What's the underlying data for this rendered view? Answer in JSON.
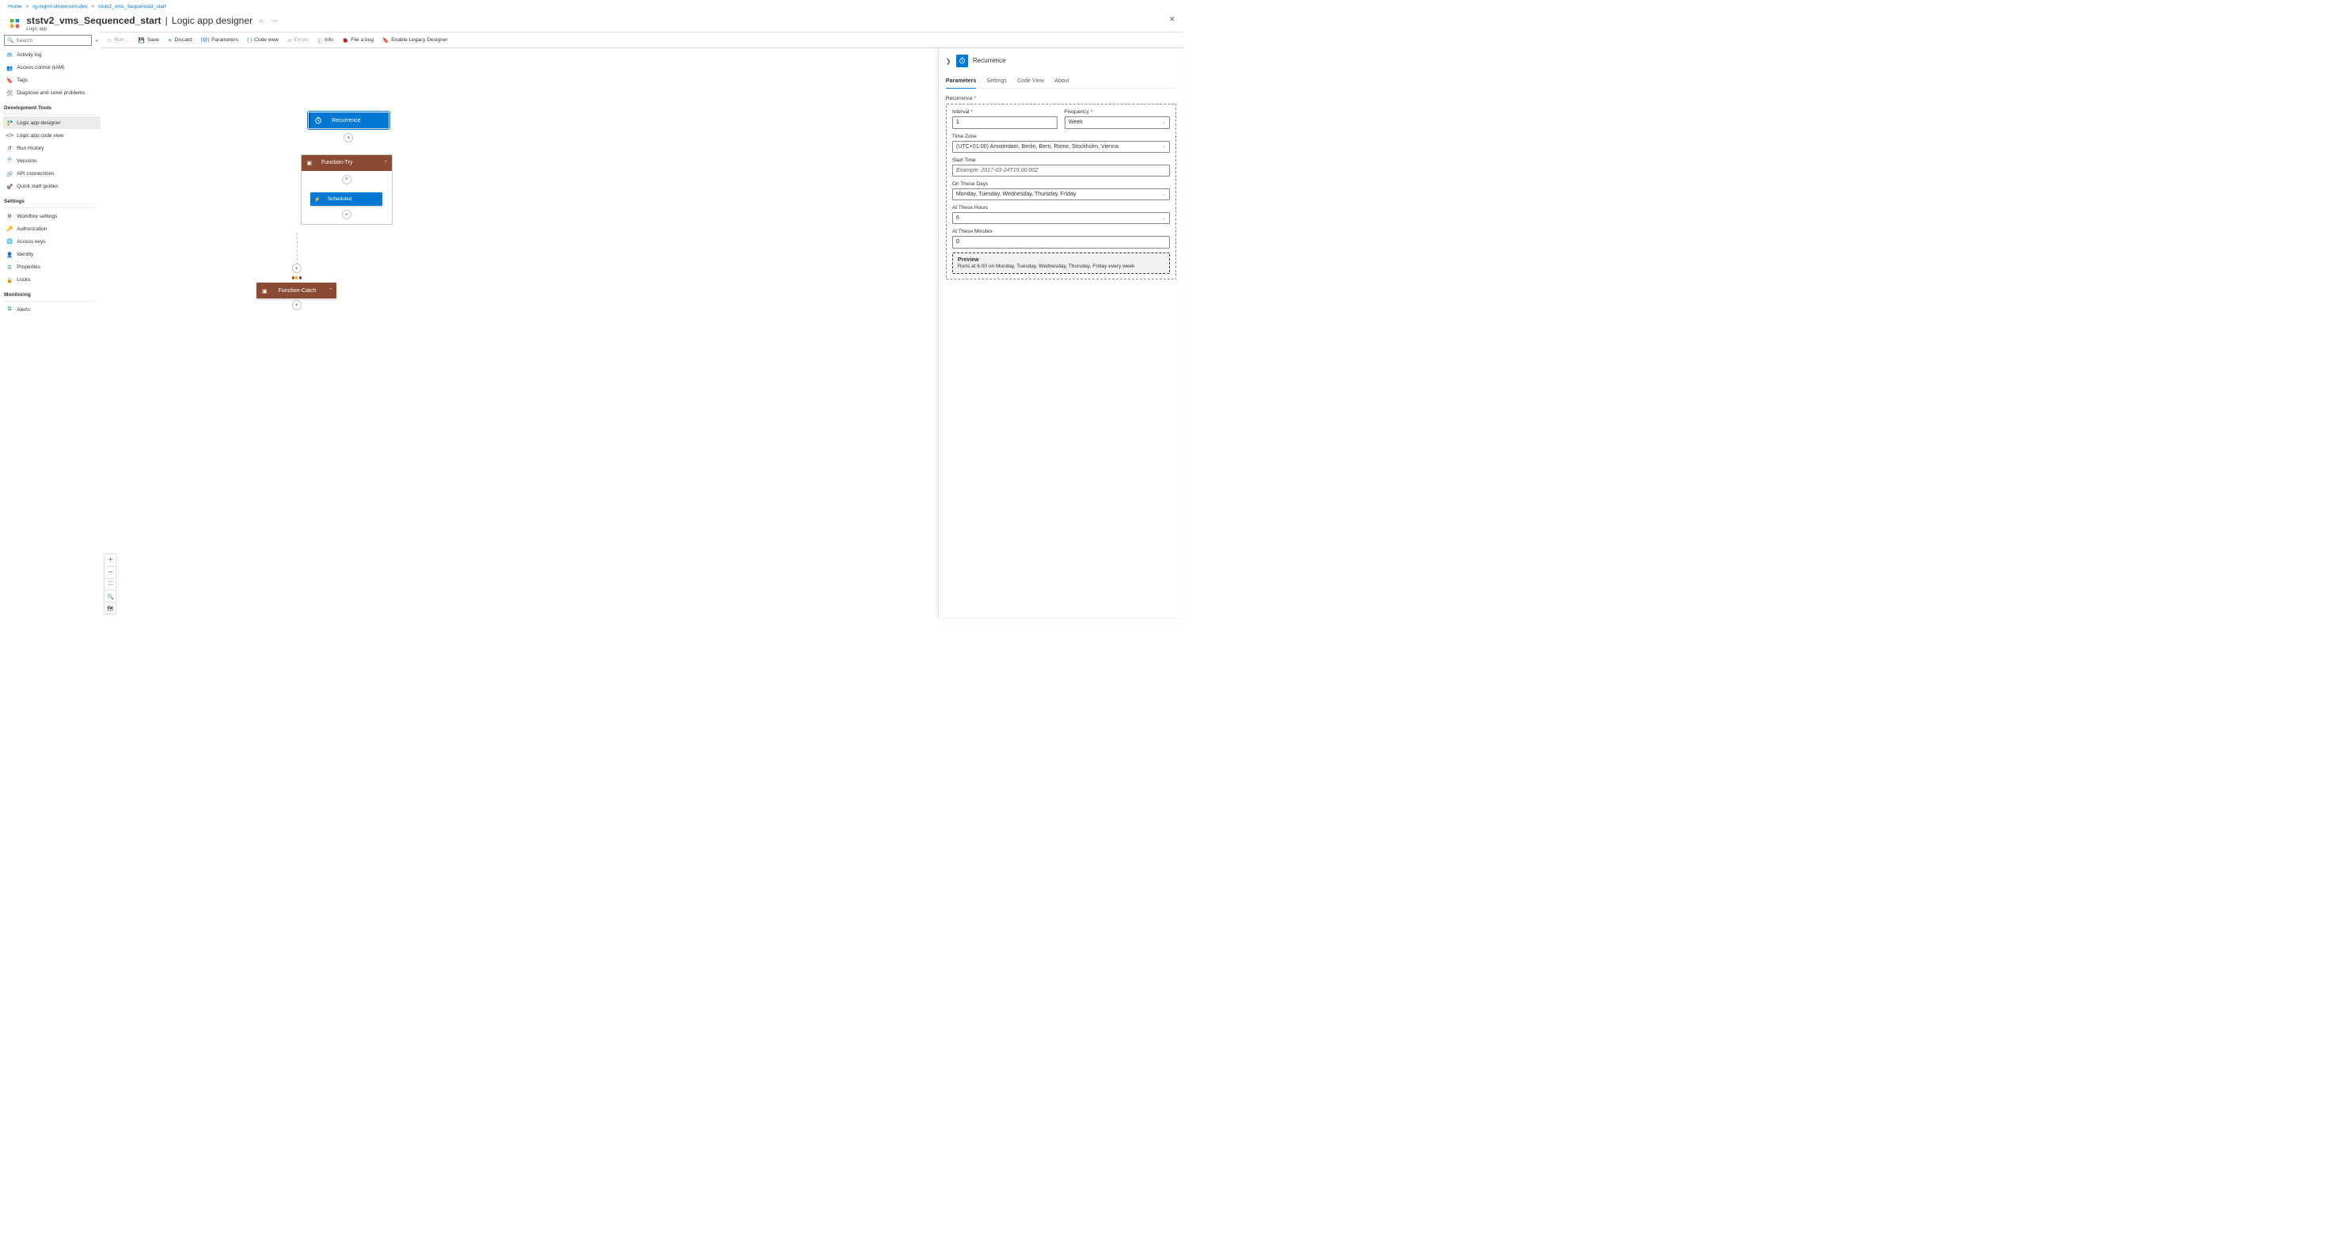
{
  "breadcrumb": {
    "home": "Home",
    "rg": "rg-mgmt-showroom-dev",
    "resource": "ststv2_vms_Sequenced_start"
  },
  "header": {
    "resource_name": "ststv2_vms_Sequenced_start",
    "separator": " | ",
    "section_title": "Logic app designer",
    "subtitle": "Logic app"
  },
  "sidebar": {
    "search_placeholder": "Search",
    "items_top": [
      {
        "label": "Activity log"
      },
      {
        "label": "Access control (IAM)"
      },
      {
        "label": "Tags"
      },
      {
        "label": "Diagnose and solve problems"
      }
    ],
    "dev_header": "Development Tools",
    "items_dev": [
      {
        "label": "Logic app designer",
        "active": true
      },
      {
        "label": "Logic app code view"
      },
      {
        "label": "Run History"
      },
      {
        "label": "Versions"
      },
      {
        "label": "API connections"
      },
      {
        "label": "Quick start guides"
      }
    ],
    "settings_header": "Settings",
    "items_settings": [
      {
        "label": "Workflow settings"
      },
      {
        "label": "Authorization"
      },
      {
        "label": "Access keys"
      },
      {
        "label": "Identity"
      },
      {
        "label": "Properties"
      },
      {
        "label": "Locks"
      }
    ],
    "monitoring_header": "Monitoring",
    "items_monitoring": [
      {
        "label": "Alerts"
      }
    ]
  },
  "toolbar": {
    "run": "Run",
    "save": "Save",
    "discard": "Discard",
    "parameters": "Parameters",
    "codeview": "Code view",
    "errors": "Errors",
    "info": "Info",
    "bug": "File a bug",
    "legacy": "Enable Legacy Designer"
  },
  "canvas": {
    "recurrence_node": "Recurrence",
    "function_try": "Function-Try",
    "scheduled_inner": "Scheduled",
    "function_catch": "Function-Catch"
  },
  "panel": {
    "title": "Recurrence",
    "tabs": {
      "parameters": "Parameters",
      "settings": "Settings",
      "codeview": "Code View",
      "about": "About"
    },
    "group_title": "Recurrence",
    "fields": {
      "interval_label": "Interval",
      "interval_value": "1",
      "frequency_label": "Frequency",
      "frequency_value": "Week",
      "tz_label": "Time Zone",
      "tz_value": "(UTC+01:00) Amsterdam, Berlin, Bern, Rome, Stockholm, Vienna",
      "start_label": "Start Time",
      "start_placeholder": "Example: 2017-03-24T15:00:00Z",
      "days_label": "On These Days",
      "days_value": "Monday, Tuesday, Wednesday, Thursday, Friday",
      "hours_label": "At These Hours",
      "hours_value": "6",
      "minutes_label": "At These Minutes",
      "minutes_value": "0"
    },
    "preview": {
      "title": "Preview",
      "text": "Runs at 6:00 on Monday, Tuesday, Wednesday, Thursday, Friday every week"
    }
  }
}
